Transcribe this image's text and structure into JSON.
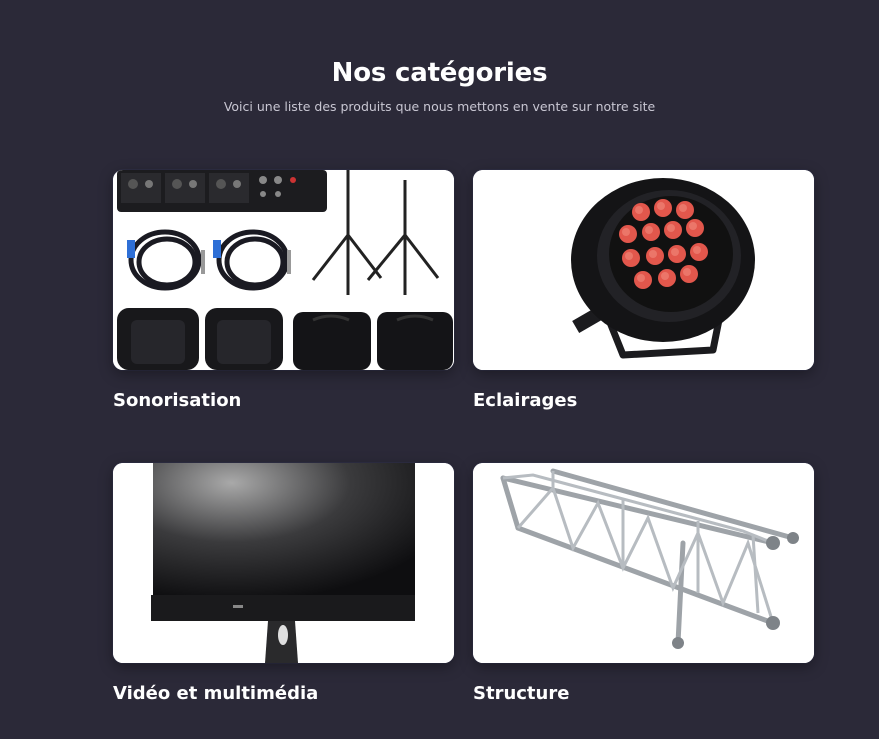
{
  "section": {
    "title": "Nos catégories",
    "subtitle": "Voici une liste des produits que nous mettons en vente sur notre site"
  },
  "categories": [
    {
      "label": "Sonorisation",
      "image": "sound-system-image"
    },
    {
      "label": "Eclairages",
      "image": "par-light-image"
    },
    {
      "label": "Vidéo et multimédia",
      "image": "monitor-image"
    },
    {
      "label": "Structure",
      "image": "truss-image"
    }
  ],
  "colors": {
    "background": "#2b2938",
    "card_background": "#ffffff",
    "text": "#ffffff",
    "subtext": "#c9c7d3",
    "led": "#e2574c"
  }
}
